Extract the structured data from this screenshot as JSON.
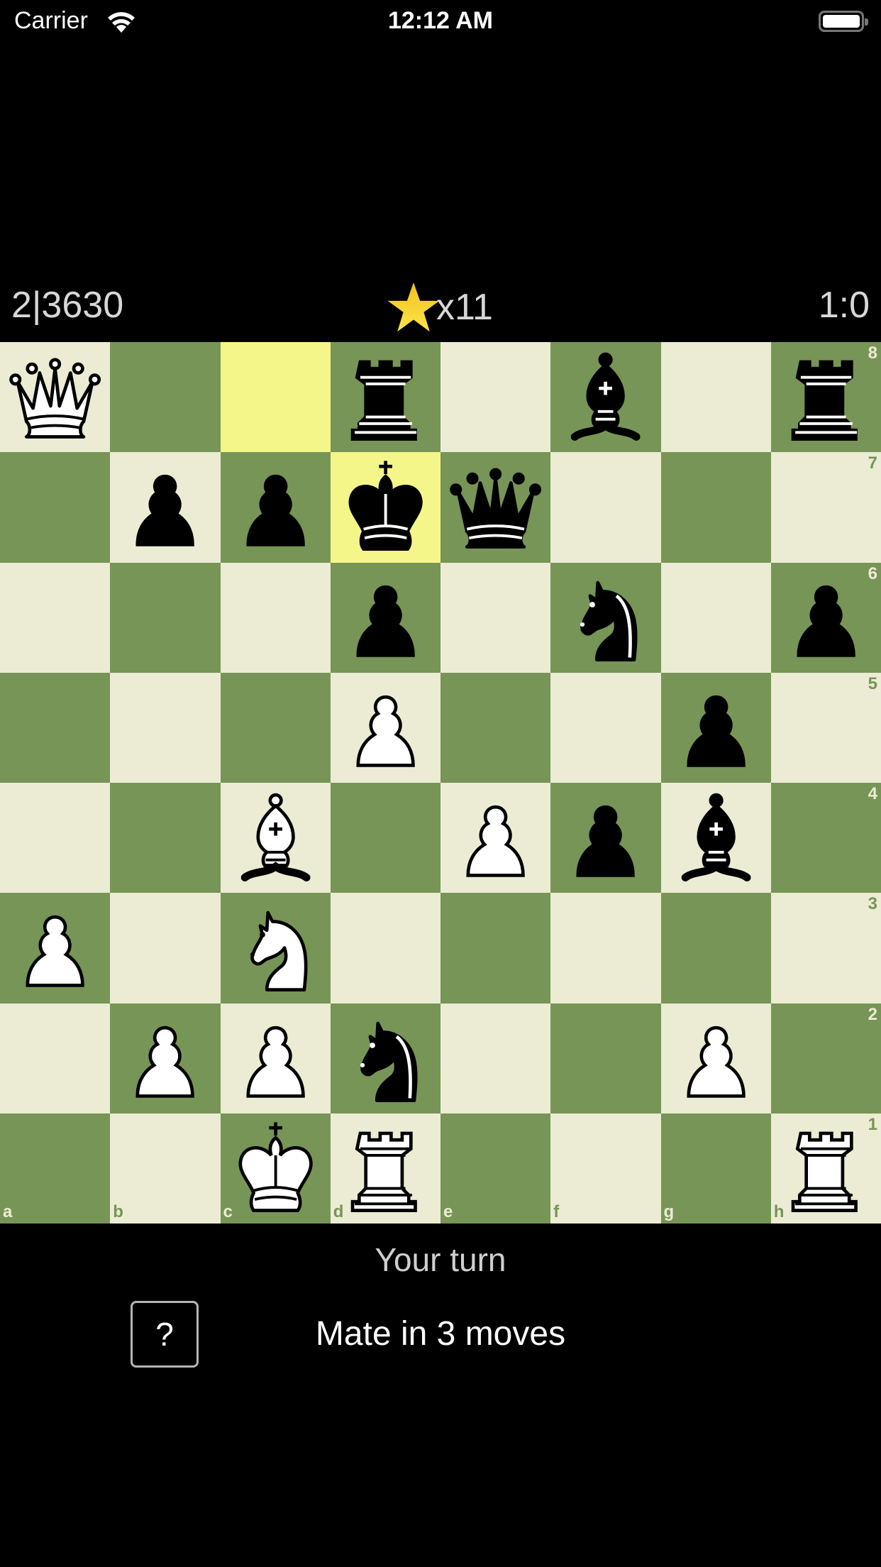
{
  "status_bar": {
    "carrier": "Carrier",
    "time": "12:12 AM",
    "wifi_icon": "wifi-icon",
    "battery_icon": "battery-icon"
  },
  "header": {
    "level": "2|3630",
    "star_icon": "star-icon",
    "stars": "x11",
    "score": "1:0"
  },
  "colors": {
    "light": "#ebecd3",
    "dark": "#779556",
    "highlight": "#f5f68a",
    "star": "#f5d327"
  },
  "board": {
    "files": [
      "a",
      "b",
      "c",
      "d",
      "e",
      "f",
      "g",
      "h"
    ],
    "ranks": [
      "8",
      "7",
      "6",
      "5",
      "4",
      "3",
      "2",
      "1"
    ],
    "highlighted": [
      "c8",
      "d7"
    ],
    "position": [
      [
        "wQ",
        "",
        "",
        "bR",
        "",
        "bB",
        "",
        "bR"
      ],
      [
        "",
        "bP",
        "bP",
        "bK",
        "bQ",
        "",
        "",
        ""
      ],
      [
        "",
        "",
        "",
        "bP",
        "",
        "bN",
        "",
        "bP"
      ],
      [
        "",
        "",
        "",
        "wP",
        "",
        "",
        "bP",
        ""
      ],
      [
        "",
        "",
        "wB",
        "",
        "wP",
        "bP",
        "bB",
        ""
      ],
      [
        "wP",
        "",
        "wN",
        "",
        "",
        "",
        "",
        ""
      ],
      [
        "",
        "wP",
        "wP",
        "bN",
        "",
        "",
        "wP",
        ""
      ],
      [
        "",
        "",
        "wK",
        "wR",
        "",
        "",
        "",
        "wR"
      ]
    ]
  },
  "footer": {
    "turn": "Your turn",
    "hint_label": "?",
    "goal": "Mate in 3 moves"
  }
}
